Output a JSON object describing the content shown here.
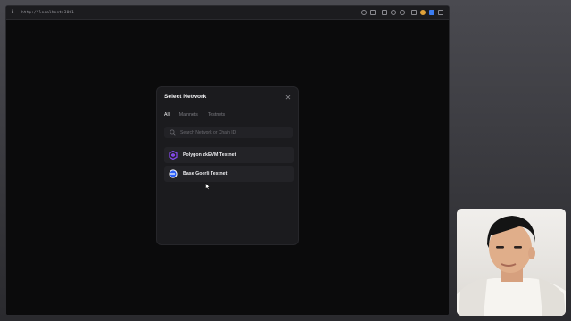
{
  "browser": {
    "url": "http://localhost:3001",
    "icons": [
      "info-icon",
      "paperclip-icon",
      "camera-icon",
      "window-icon",
      "globe-icon",
      "settings-icon",
      "extension-icon",
      "metamask-icon",
      "wallet-icon",
      "sidebar-icon"
    ]
  },
  "modal": {
    "title": "Select Network",
    "tabs": [
      {
        "label": "All",
        "active": true
      },
      {
        "label": "Mainnets",
        "active": false
      },
      {
        "label": "Testnets",
        "active": false
      }
    ],
    "search": {
      "placeholder": "Search Network or Chain ID",
      "value": ""
    },
    "networks": [
      {
        "label": "Polygon zkEVM Testnet",
        "icon": "polygon-icon",
        "color": "#8247e5"
      },
      {
        "label": "Base Goerli Testnet",
        "icon": "base-icon",
        "color": "#2c5ff6"
      }
    ]
  },
  "colors": {
    "modal_bg": "#1b1b1e",
    "item_bg": "#232327",
    "accent_polygon": "#8247e5",
    "accent_base": "#2c5ff6"
  }
}
